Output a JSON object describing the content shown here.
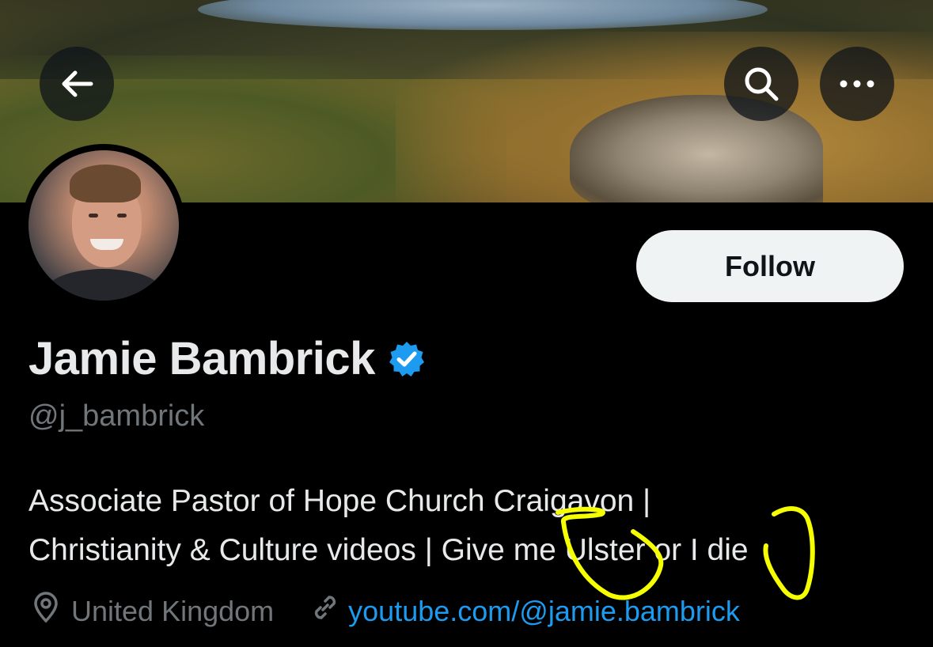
{
  "profile": {
    "name": "Jamie Bambrick",
    "handle": "@j_bambrick",
    "bio_line1": "Associate Pastor of Hope Church Craigavon |",
    "bio_line2": "Christianity & Culture videos | Give me Ulster or I die",
    "location": "United Kingdom",
    "website": "youtube.com/@jamie.bambrick",
    "verified": true
  },
  "actions": {
    "follow_label": "Follow"
  },
  "icons": {
    "back": "arrow-left-icon",
    "search": "search-icon",
    "more": "more-dots-icon",
    "verified": "verified-badge-icon",
    "location": "location-pin-icon",
    "link": "link-icon"
  },
  "colors": {
    "background": "#000000",
    "follow_button_bg": "#eff3f4",
    "verified_blue": "#1d9bf0",
    "link_blue": "#1d9bf0",
    "secondary_text": "#71767b",
    "annotation_yellow": "#f5ff00"
  }
}
